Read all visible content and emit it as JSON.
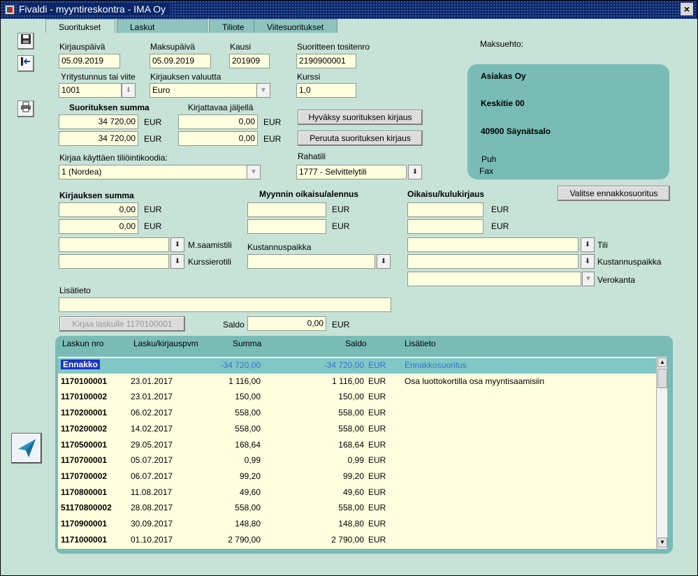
{
  "window": {
    "title": "Fivaldi - myyntireskontra - IMA Oy",
    "close_label": "×"
  },
  "tabs": [
    "Suoritukset",
    "Laskut",
    "Tiliote",
    "Viitesuoritukset"
  ],
  "header": {
    "kirjauspaiva_label": "Kirjauspäivä",
    "kirjauspaiva": "05.09.2019",
    "maksupaiva_label": "Maksupäivä",
    "maksupaiva": "05.09.2019",
    "kausi_label": "Kausi",
    "kausi": "201909",
    "tositenro_label": "Suoritteen tositenro",
    "tositenro": "2190900001",
    "maksuehto_label": "Maksuehto:",
    "yritystunnus_label": "Yritystunnus tai viite",
    "yritystunnus": "1001",
    "valuutta_label": "Kirjauksen valuutta",
    "valuutta": "Euro",
    "kurssi_label": "Kurssi",
    "kurssi": "1,0"
  },
  "summat": {
    "suoritus_label": "Suorituksen summa",
    "suoritus1": "34 720,00",
    "suoritus2": "34 720,00",
    "jaljella_label": "Kirjattavaa jäljellä",
    "jaljella1": "0,00",
    "jaljella2": "0,00",
    "eur": "EUR"
  },
  "buttons": {
    "hyvaksy": "Hyväksy suorituksen kirjaus",
    "peruuta": "Peruuta suorituksen kirjaus",
    "valitse": "Valitse ennakkosuoritus",
    "kirjaa": "Kirjaa laskulle 1170100001"
  },
  "tiliointi": {
    "koodi_label": "Kirjaa käyttäen tiliöintikoodia:",
    "koodi": "1 (Nordea)",
    "rahatili_label": "Rahatili",
    "rahatili": "1777 - Selvittelytili"
  },
  "customer": {
    "name": "Asiakas Oy",
    "street": "Keskitie 00",
    "city": "40900 Säynätsalo",
    "puh_label": "Puh",
    "fax_label": "Fax"
  },
  "kirjaus": {
    "summa_label": "Kirjauksen summa",
    "summa1": "0,00",
    "summa2": "0,00",
    "msaamistili_label": "M.saamistili",
    "kurssierotili_label": "Kurssierotili",
    "oikaisu_label": "Myynnin oikaisu/alennus",
    "kustannuspaikka_label": "Kustannuspaikka",
    "kulu_label": "Oikaisu/kulukirjaus",
    "tili_label": "Tili",
    "kustannuspaikka2_label": "Kustannuspaikka",
    "verokanta_label": "Verokanta",
    "lisatieto_label": "Lisätieto",
    "saldo_label": "Saldo",
    "saldo": "0,00"
  },
  "table": {
    "columns": [
      "Laskun nro",
      "Lasku/kirjauspvm",
      "Summa",
      "Saldo",
      "Lisätieto"
    ],
    "rows": [
      {
        "nro": "Ennakko",
        "pvm": "",
        "summa": "-34 720,00",
        "saldo": "-34 720,00",
        "cur": "EUR",
        "info": "Ennakkosuoritus"
      },
      {
        "nro": "1170100001",
        "pvm": "23.01.2017",
        "summa": "1 116,00",
        "saldo": "1 116,00",
        "cur": "EUR",
        "info": "Osa luottokortilla osa myyntisaamisiin"
      },
      {
        "nro": "1170100002",
        "pvm": "23.01.2017",
        "summa": "150,00",
        "saldo": "150,00",
        "cur": "EUR",
        "info": ""
      },
      {
        "nro": "1170200001",
        "pvm": "06.02.2017",
        "summa": "558,00",
        "saldo": "558,00",
        "cur": "EUR",
        "info": ""
      },
      {
        "nro": "1170200002",
        "pvm": "14.02.2017",
        "summa": "558,00",
        "saldo": "558,00",
        "cur": "EUR",
        "info": ""
      },
      {
        "nro": "1170500001",
        "pvm": "29.05.2017",
        "summa": "168,64",
        "saldo": "168,64",
        "cur": "EUR",
        "info": ""
      },
      {
        "nro": "1170700001",
        "pvm": "05.07.2017",
        "summa": "0,99",
        "saldo": "0,99",
        "cur": "EUR",
        "info": ""
      },
      {
        "nro": "1170700002",
        "pvm": "06.07.2017",
        "summa": "99,20",
        "saldo": "99,20",
        "cur": "EUR",
        "info": ""
      },
      {
        "nro": "1170800001",
        "pvm": "11.08.2017",
        "summa": "49,60",
        "saldo": "49,60",
        "cur": "EUR",
        "info": ""
      },
      {
        "nro": "51170800002",
        "pvm": "28.08.2017",
        "summa": "558,00",
        "saldo": "558,00",
        "cur": "EUR",
        "info": ""
      },
      {
        "nro": "1170900001",
        "pvm": "30.09.2017",
        "summa": "148,80",
        "saldo": "148,80",
        "cur": "EUR",
        "info": ""
      },
      {
        "nro": "1171000001",
        "pvm": "01.10.2017",
        "summa": "2 790,00",
        "saldo": "2 790,00",
        "cur": "EUR",
        "info": ""
      }
    ]
  },
  "icons": [
    "save-icon",
    "exit-icon",
    "print-icon",
    "fivaldi-logo-icon",
    "dropdown-arrow-icon"
  ]
}
